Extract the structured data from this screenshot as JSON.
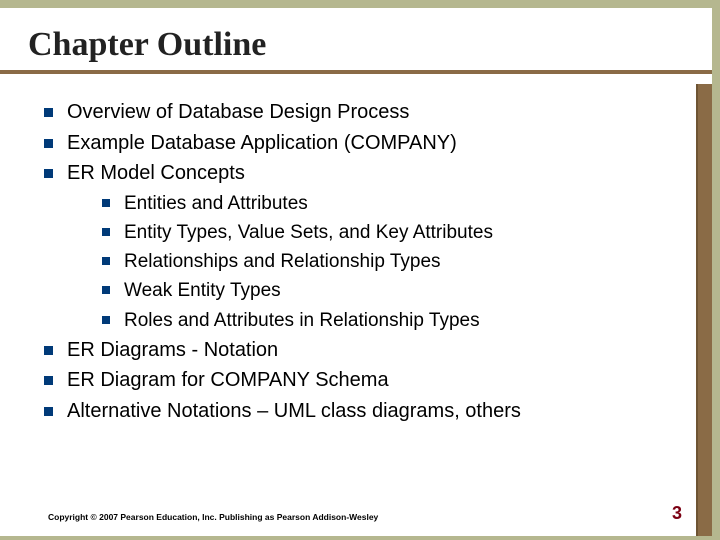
{
  "title": "Chapter Outline",
  "items": {
    "i0": "Overview of Database Design Process",
    "i1": "Example Database Application (COMPANY)",
    "i2": "ER Model Concepts",
    "s0": "Entities and Attributes",
    "s1": "Entity Types, Value Sets, and Key Attributes",
    "s2": "Relationships and Relationship Types",
    "s3": "Weak Entity Types",
    "s4": "Roles and Attributes in Relationship Types",
    "i3": "ER Diagrams - Notation",
    "i4": "ER Diagram for COMPANY Schema",
    "i5": "Alternative Notations – UML class diagrams, others"
  },
  "footer": "Copyright © 2007 Pearson Education, Inc. Publishing as Pearson Addison-Wesley",
  "page": "3"
}
